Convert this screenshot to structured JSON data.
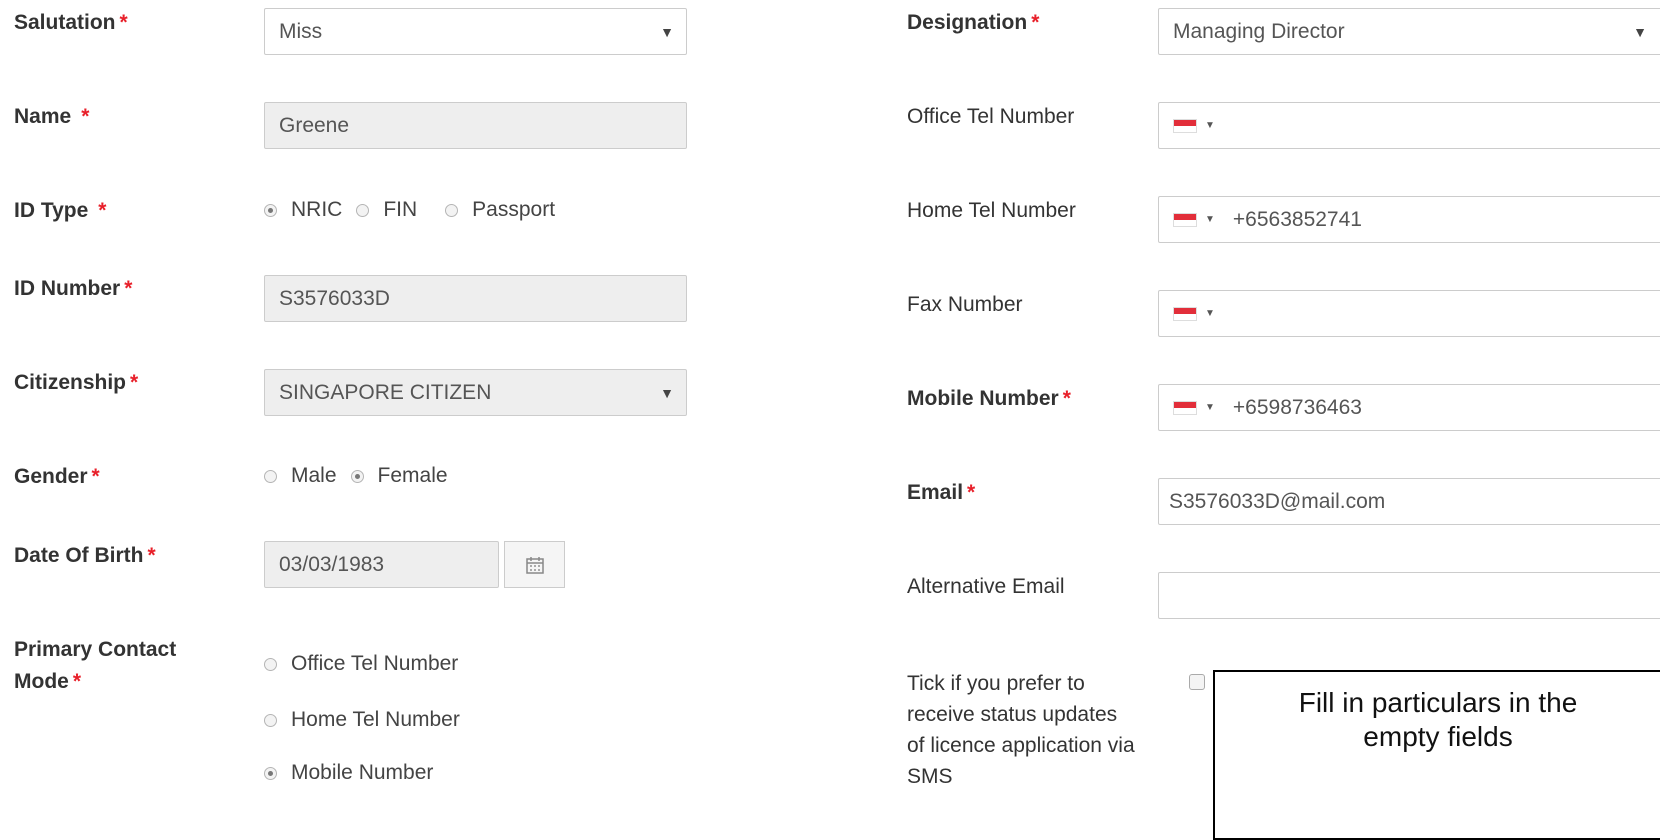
{
  "left": {
    "salutation": {
      "label": "Salutation",
      "value": "Miss"
    },
    "name": {
      "label": "Name",
      "value": "Greene"
    },
    "id_type": {
      "label": "ID Type",
      "options": [
        "NRIC",
        "FIN",
        "Passport"
      ],
      "selected": "NRIC"
    },
    "id_number": {
      "label": "ID Number",
      "value": "S3576033D"
    },
    "citizenship": {
      "label": "Citizenship",
      "value": "SINGAPORE CITIZEN"
    },
    "gender": {
      "label": "Gender",
      "options": [
        "Male",
        "Female"
      ],
      "selected": "Female"
    },
    "dob": {
      "label": "Date Of Birth",
      "value": "03/03/1983"
    },
    "primary_contact": {
      "label_line1": "Primary Contact",
      "label_line2": "Mode",
      "options": [
        "Office Tel Number",
        "Home Tel Number",
        "Mobile Number"
      ],
      "selected": "Mobile Number"
    }
  },
  "right": {
    "designation": {
      "label": "Designation",
      "value": "Managing Director"
    },
    "office_tel": {
      "label": "Office Tel Number",
      "value": ""
    },
    "home_tel": {
      "label": "Home Tel Number",
      "value": "+6563852741"
    },
    "fax": {
      "label": "Fax Number",
      "value": ""
    },
    "mobile": {
      "label": "Mobile Number",
      "value": "+6598736463"
    },
    "email": {
      "label": "Email",
      "value": "S3576033D@mail.com"
    },
    "alt_email": {
      "label": "Alternative Email",
      "value": ""
    },
    "sms_pref": {
      "lines": [
        "Tick if you prefer to",
        "receive status updates",
        "of licence application via",
        "SMS"
      ],
      "checked": false
    }
  },
  "required_mark": "*",
  "note": {
    "line1": "Fill in particulars in the",
    "line2": "empty fields"
  },
  "colors": {
    "required": "#e8202a",
    "disabled_bg": "#eeeeee",
    "border": "#cccccc"
  }
}
